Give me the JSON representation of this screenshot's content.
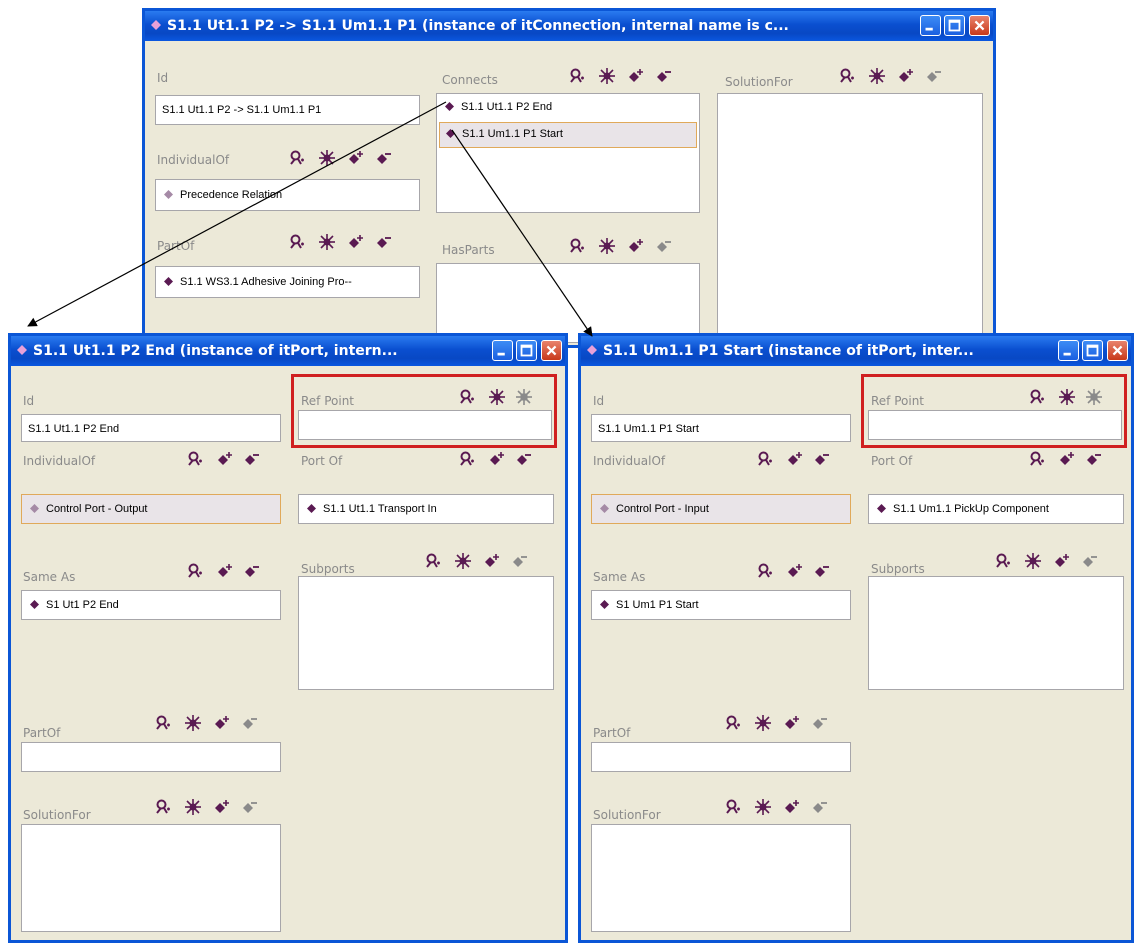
{
  "colors": {
    "accent": "#0b56d6",
    "icon_purple": "#5a1a52",
    "icon_disabled": "#8a8a8a",
    "highlight_border": "#d02020"
  },
  "top": {
    "title": "S1.1 Ut1.1 P2 -> S1.1 Um1.1 P1    (instance of itConnection, internal name is c...",
    "id_label": "Id",
    "id_value": "S1.1 Ut1.1 P2 -> S1.1 Um1.1 P1",
    "individualof_label": "IndividualOf",
    "individualof_value": "Precedence Relation",
    "partof_label": "PartOf",
    "partof_value": "S1.1 WS3.1 Adhesive Joining Pro--",
    "connects_label": "Connects",
    "connects_items": [
      "S1.1 Ut1.1 P2 End",
      "S1.1 Um1.1 P1 Start"
    ],
    "hasparts_label": "HasParts",
    "solutionfor_label": "SolutionFor"
  },
  "left": {
    "title": "S1.1 Ut1.1 P2 End   (instance of itPort, intern...",
    "id_label": "Id",
    "id_value": "S1.1 Ut1.1 P2 End",
    "individualof_label": "IndividualOf",
    "individualof_value": "Control Port - Output",
    "sameas_label": "Same As",
    "sameas_value": "S1 Ut1 P2 End",
    "partof_label": "PartOf",
    "solutionfor_label": "SolutionFor",
    "refpoint_label": "Ref Point",
    "portof_label": "Port Of",
    "portof_value": "S1.1 Ut1.1 Transport In",
    "subports_label": "Subports"
  },
  "right": {
    "title": "S1.1 Um1.1 P1 Start   (instance of itPort, inter...",
    "id_label": "Id",
    "id_value": "S1.1 Um1.1 P1 Start",
    "individualof_label": "IndividualOf",
    "individualof_value": "Control Port - Input",
    "sameas_label": "Same As",
    "sameas_value": "S1 Um1 P1 Start",
    "partof_label": "PartOf",
    "solutionfor_label": "SolutionFor",
    "refpoint_label": "Ref Point",
    "portof_label": "Port Of",
    "portof_value": "S1.1 Um1.1 PickUp Component",
    "subports_label": "Subports"
  }
}
